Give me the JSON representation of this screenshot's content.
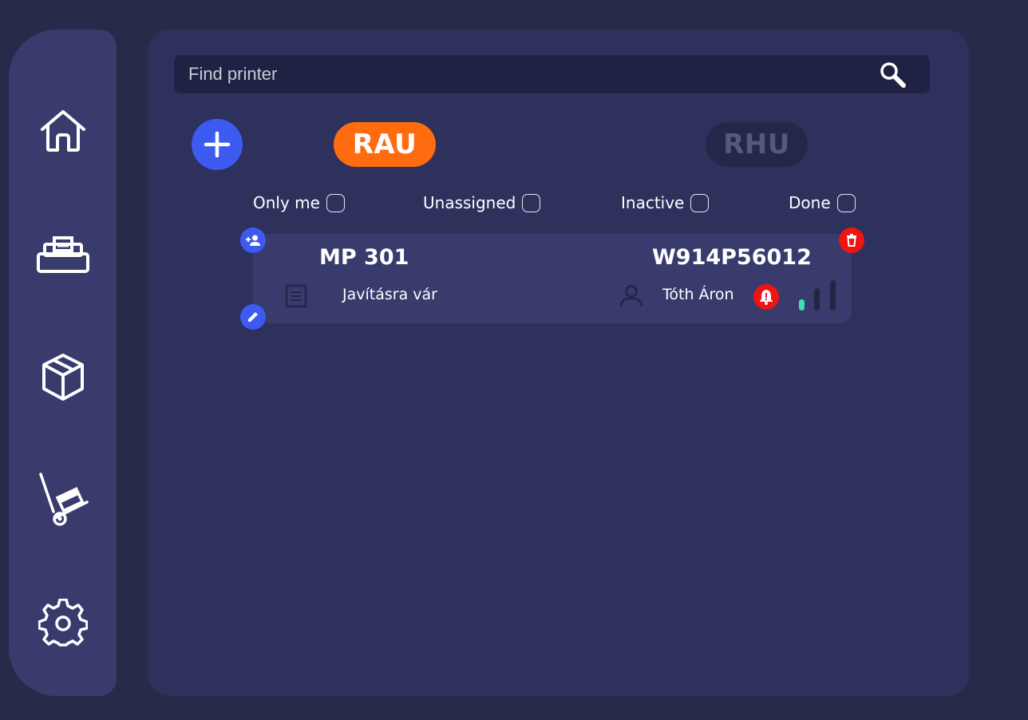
{
  "sidebar": {
    "items": [
      {
        "name": "home",
        "icon": "home-icon"
      },
      {
        "name": "printers",
        "icon": "printer-icon"
      },
      {
        "name": "packages",
        "icon": "box-icon"
      },
      {
        "name": "delivery",
        "icon": "hand-truck-icon"
      },
      {
        "name": "settings",
        "icon": "gear-icon"
      }
    ]
  },
  "search": {
    "placeholder": "Find printer",
    "value": "",
    "icon": "search-icon"
  },
  "tabs": [
    {
      "label": "RAU",
      "active": true,
      "color": "#ff6c10"
    },
    {
      "label": "RHU",
      "active": false,
      "color": "#24274a"
    }
  ],
  "filters": [
    {
      "label": "Only me",
      "checked": false
    },
    {
      "label": "Unassigned",
      "checked": false
    },
    {
      "label": "Inactive",
      "checked": false
    },
    {
      "label": "Done",
      "checked": false
    }
  ],
  "printer_card": {
    "model": "MP 301",
    "serial": "W914P56012",
    "status": "Javításra vár",
    "assignee": "Tóth Áron",
    "signal_level": 1,
    "signal_max": 3,
    "alert": true
  },
  "colors": {
    "background": "#272a49",
    "panel": "#2e315c",
    "sidebar": "#383b6c",
    "accent_blue": "#3d5af1",
    "accent_orange": "#ff6c10",
    "danger": "#f01313",
    "signal_active": "#3be3b2"
  }
}
